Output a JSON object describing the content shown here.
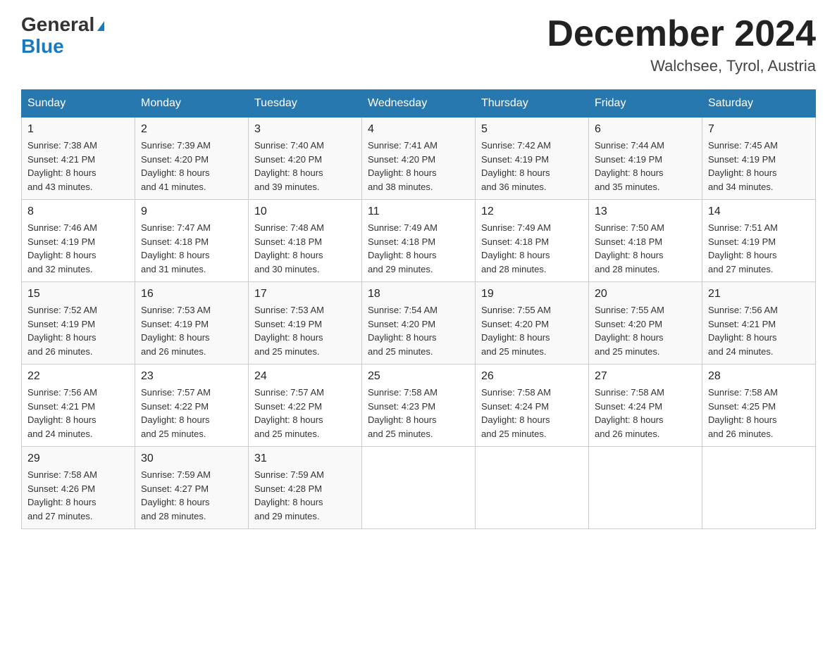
{
  "header": {
    "logo_general": "General",
    "logo_blue": "Blue",
    "month_year": "December 2024",
    "location": "Walchsee, Tyrol, Austria"
  },
  "days_of_week": [
    "Sunday",
    "Monday",
    "Tuesday",
    "Wednesday",
    "Thursday",
    "Friday",
    "Saturday"
  ],
  "weeks": [
    [
      {
        "day": "1",
        "sunrise": "7:38 AM",
        "sunset": "4:21 PM",
        "daylight": "8 hours and 43 minutes."
      },
      {
        "day": "2",
        "sunrise": "7:39 AM",
        "sunset": "4:20 PM",
        "daylight": "8 hours and 41 minutes."
      },
      {
        "day": "3",
        "sunrise": "7:40 AM",
        "sunset": "4:20 PM",
        "daylight": "8 hours and 39 minutes."
      },
      {
        "day": "4",
        "sunrise": "7:41 AM",
        "sunset": "4:20 PM",
        "daylight": "8 hours and 38 minutes."
      },
      {
        "day": "5",
        "sunrise": "7:42 AM",
        "sunset": "4:19 PM",
        "daylight": "8 hours and 36 minutes."
      },
      {
        "day": "6",
        "sunrise": "7:44 AM",
        "sunset": "4:19 PM",
        "daylight": "8 hours and 35 minutes."
      },
      {
        "day": "7",
        "sunrise": "7:45 AM",
        "sunset": "4:19 PM",
        "daylight": "8 hours and 34 minutes."
      }
    ],
    [
      {
        "day": "8",
        "sunrise": "7:46 AM",
        "sunset": "4:19 PM",
        "daylight": "8 hours and 32 minutes."
      },
      {
        "day": "9",
        "sunrise": "7:47 AM",
        "sunset": "4:18 PM",
        "daylight": "8 hours and 31 minutes."
      },
      {
        "day": "10",
        "sunrise": "7:48 AM",
        "sunset": "4:18 PM",
        "daylight": "8 hours and 30 minutes."
      },
      {
        "day": "11",
        "sunrise": "7:49 AM",
        "sunset": "4:18 PM",
        "daylight": "8 hours and 29 minutes."
      },
      {
        "day": "12",
        "sunrise": "7:49 AM",
        "sunset": "4:18 PM",
        "daylight": "8 hours and 28 minutes."
      },
      {
        "day": "13",
        "sunrise": "7:50 AM",
        "sunset": "4:18 PM",
        "daylight": "8 hours and 28 minutes."
      },
      {
        "day": "14",
        "sunrise": "7:51 AM",
        "sunset": "4:19 PM",
        "daylight": "8 hours and 27 minutes."
      }
    ],
    [
      {
        "day": "15",
        "sunrise": "7:52 AM",
        "sunset": "4:19 PM",
        "daylight": "8 hours and 26 minutes."
      },
      {
        "day": "16",
        "sunrise": "7:53 AM",
        "sunset": "4:19 PM",
        "daylight": "8 hours and 26 minutes."
      },
      {
        "day": "17",
        "sunrise": "7:53 AM",
        "sunset": "4:19 PM",
        "daylight": "8 hours and 25 minutes."
      },
      {
        "day": "18",
        "sunrise": "7:54 AM",
        "sunset": "4:20 PM",
        "daylight": "8 hours and 25 minutes."
      },
      {
        "day": "19",
        "sunrise": "7:55 AM",
        "sunset": "4:20 PM",
        "daylight": "8 hours and 25 minutes."
      },
      {
        "day": "20",
        "sunrise": "7:55 AM",
        "sunset": "4:20 PM",
        "daylight": "8 hours and 25 minutes."
      },
      {
        "day": "21",
        "sunrise": "7:56 AM",
        "sunset": "4:21 PM",
        "daylight": "8 hours and 24 minutes."
      }
    ],
    [
      {
        "day": "22",
        "sunrise": "7:56 AM",
        "sunset": "4:21 PM",
        "daylight": "8 hours and 24 minutes."
      },
      {
        "day": "23",
        "sunrise": "7:57 AM",
        "sunset": "4:22 PM",
        "daylight": "8 hours and 25 minutes."
      },
      {
        "day": "24",
        "sunrise": "7:57 AM",
        "sunset": "4:22 PM",
        "daylight": "8 hours and 25 minutes."
      },
      {
        "day": "25",
        "sunrise": "7:58 AM",
        "sunset": "4:23 PM",
        "daylight": "8 hours and 25 minutes."
      },
      {
        "day": "26",
        "sunrise": "7:58 AM",
        "sunset": "4:24 PM",
        "daylight": "8 hours and 25 minutes."
      },
      {
        "day": "27",
        "sunrise": "7:58 AM",
        "sunset": "4:24 PM",
        "daylight": "8 hours and 26 minutes."
      },
      {
        "day": "28",
        "sunrise": "7:58 AM",
        "sunset": "4:25 PM",
        "daylight": "8 hours and 26 minutes."
      }
    ],
    [
      {
        "day": "29",
        "sunrise": "7:58 AM",
        "sunset": "4:26 PM",
        "daylight": "8 hours and 27 minutes."
      },
      {
        "day": "30",
        "sunrise": "7:59 AM",
        "sunset": "4:27 PM",
        "daylight": "8 hours and 28 minutes."
      },
      {
        "day": "31",
        "sunrise": "7:59 AM",
        "sunset": "4:28 PM",
        "daylight": "8 hours and 29 minutes."
      },
      null,
      null,
      null,
      null
    ]
  ],
  "labels": {
    "sunrise": "Sunrise:",
    "sunset": "Sunset:",
    "daylight": "Daylight:"
  }
}
